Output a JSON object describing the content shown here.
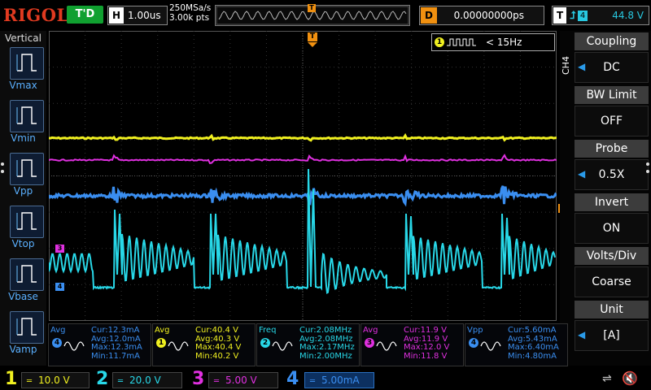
{
  "top": {
    "logo": "RIGOL",
    "trigger_status": "T'D",
    "horizontal": {
      "key": "H",
      "value": "1.00us"
    },
    "sample_rate": "250MSa/s",
    "memory_depth": "3.00k pts",
    "delay": {
      "key": "D",
      "value": "0.00000000ps"
    },
    "trigger": {
      "key": "T",
      "edge_icon": "rising-edge-icon",
      "source": "4",
      "level": "44.8 V"
    }
  },
  "trigger_marker": "T",
  "channel_markers": {
    "ch3": "3",
    "ch4": "4"
  },
  "freq_counter": {
    "channel": "1",
    "text": "< 15Hz"
  },
  "left_panel": {
    "title": "Vertical",
    "items": [
      {
        "label": "Vmax",
        "icon": "vmax-icon"
      },
      {
        "label": "Vmin",
        "icon": "vmin-icon"
      },
      {
        "label": "Vpp",
        "icon": "vpp-icon"
      },
      {
        "label": "Vtop",
        "icon": "vtop-icon"
      },
      {
        "label": "Vbase",
        "icon": "vbase-icon"
      },
      {
        "label": "Vamp",
        "icon": "vamp-icon"
      }
    ]
  },
  "right_panel": {
    "channel_tag": "CH4",
    "menus": [
      {
        "title": "Coupling",
        "value": "DC"
      },
      {
        "title": "BW Limit",
        "value": "OFF"
      },
      {
        "title": "Probe",
        "value": "0.5X"
      },
      {
        "title": "Invert",
        "value": "ON"
      },
      {
        "title": "Volts/Div",
        "value": "Coarse"
      },
      {
        "title": "Unit",
        "value": "[A]"
      }
    ]
  },
  "measurements": [
    {
      "type": "Avg",
      "channel": "4",
      "color": "#3a8ef0",
      "cur": "Cur:12.3mA",
      "avg": "Avg:12.0mA",
      "max": "Max:12.3mA",
      "min": "Min:11.7mA"
    },
    {
      "type": "Avg",
      "channel": "1",
      "color": "#f0f020",
      "cur": "Cur:40.4 V",
      "avg": "Avg:40.3 V",
      "max": "Max:40.4 V",
      "min": "Min:40.2 V"
    },
    {
      "type": "Freq",
      "channel": "2",
      "color": "#28d8e8",
      "cur": "Cur:2.08MHz",
      "avg": "Avg:2.08MHz",
      "max": "Max:2.17MHz",
      "min": "Min:2.00MHz"
    },
    {
      "type": "Avg",
      "channel": "3",
      "color": "#e030e0",
      "cur": "Cur:11.9 V",
      "avg": "Avg:11.9 V",
      "max": "Max:12.0 V",
      "min": "Min:11.8 V"
    },
    {
      "type": "Vpp",
      "channel": "4",
      "color": "#3a8ef0",
      "cur": "Cur:5.60mA",
      "avg": "Avg:5.43mA",
      "max": "Max:6.40mA",
      "min": "Min:4.80mA"
    }
  ],
  "channels": [
    {
      "num": "1",
      "scale": "10.0 V",
      "color": "#f0f020"
    },
    {
      "num": "2",
      "scale": "20.0 V",
      "color": "#28d8e8"
    },
    {
      "num": "3",
      "scale": "5.00 V",
      "color": "#e030e0"
    },
    {
      "num": "4",
      "scale": "5.00mA",
      "color": "#3a8ef0"
    }
  ],
  "colors": {
    "ch1": "#f0f020",
    "ch2": "#28d8e8",
    "ch3": "#e030e0",
    "ch4": "#3a8ef0",
    "trigger": "#f09010",
    "accent": "#2a9ae8"
  }
}
